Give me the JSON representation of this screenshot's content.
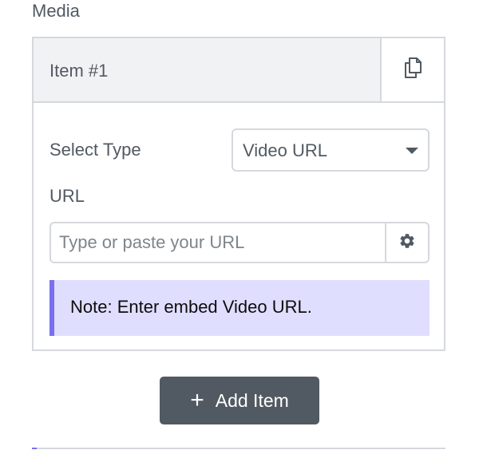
{
  "section": {
    "label": "Media"
  },
  "item": {
    "title": "Item #1",
    "duplicate_icon": "duplicate-icon"
  },
  "fields": {
    "select_type_label": "Select Type",
    "select_type_value": "Video URL",
    "url_label": "URL",
    "url_placeholder": "Type or paste your URL",
    "url_value": "",
    "settings_icon": "gear-icon"
  },
  "note": {
    "text": "Note: Enter embed Video URL."
  },
  "add_button": {
    "icon": "+",
    "label": "Add Item"
  },
  "colors": {
    "text": "#515962",
    "border": "#d5d8dc",
    "header_bg": "#f1f2f3",
    "note_bg": "#e0defe",
    "note_accent": "#7a6ff0",
    "button_bg": "#515962"
  }
}
